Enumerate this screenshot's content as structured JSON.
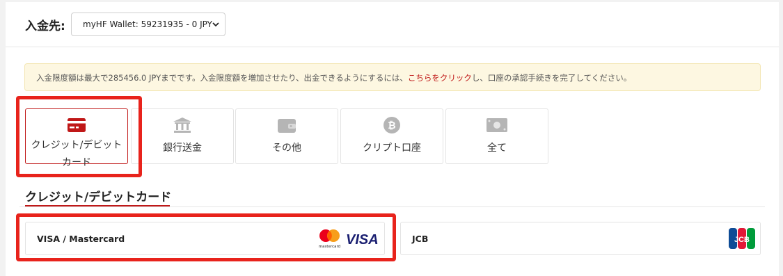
{
  "header": {
    "deposit_to_label": "入金先:",
    "account_select_value": "myHF Wallet: 59231935 - 0 JPY"
  },
  "notice": {
    "text_before": "入金限度額は最大で285456.0 JPYまでです。入金限度額を増加させたり、出金できるようにするには、",
    "link_text": "こちらをクリック",
    "text_after": "し、口座の承認手続きを完了してください。"
  },
  "methods": [
    {
      "label": "クレジット/デビットカード",
      "icon": "credit-card-icon",
      "active": true
    },
    {
      "label": "銀行送金",
      "icon": "bank-icon",
      "active": false
    },
    {
      "label": "その他",
      "icon": "wallet-icon",
      "active": false
    },
    {
      "label": "クリプト口座",
      "icon": "bitcoin-icon",
      "active": false
    },
    {
      "label": "全て",
      "icon": "cash-icon",
      "active": false
    }
  ],
  "section": {
    "title": "クレジット/デビットカード"
  },
  "cards": [
    {
      "name": "VISA / Mastercard",
      "logo": "visa-mastercard-logo",
      "logo_text": "VISA",
      "mc_text": "mastercard"
    },
    {
      "name": "JCB",
      "logo": "jcb-logo",
      "logo_text": "JCB"
    }
  ],
  "colors": {
    "accent": "#c01818",
    "highlight_box": "#e8231c",
    "notice_bg": "#fdf7e1",
    "icon_gray": "#b5b5b5",
    "visa_blue": "#1a1f71"
  }
}
